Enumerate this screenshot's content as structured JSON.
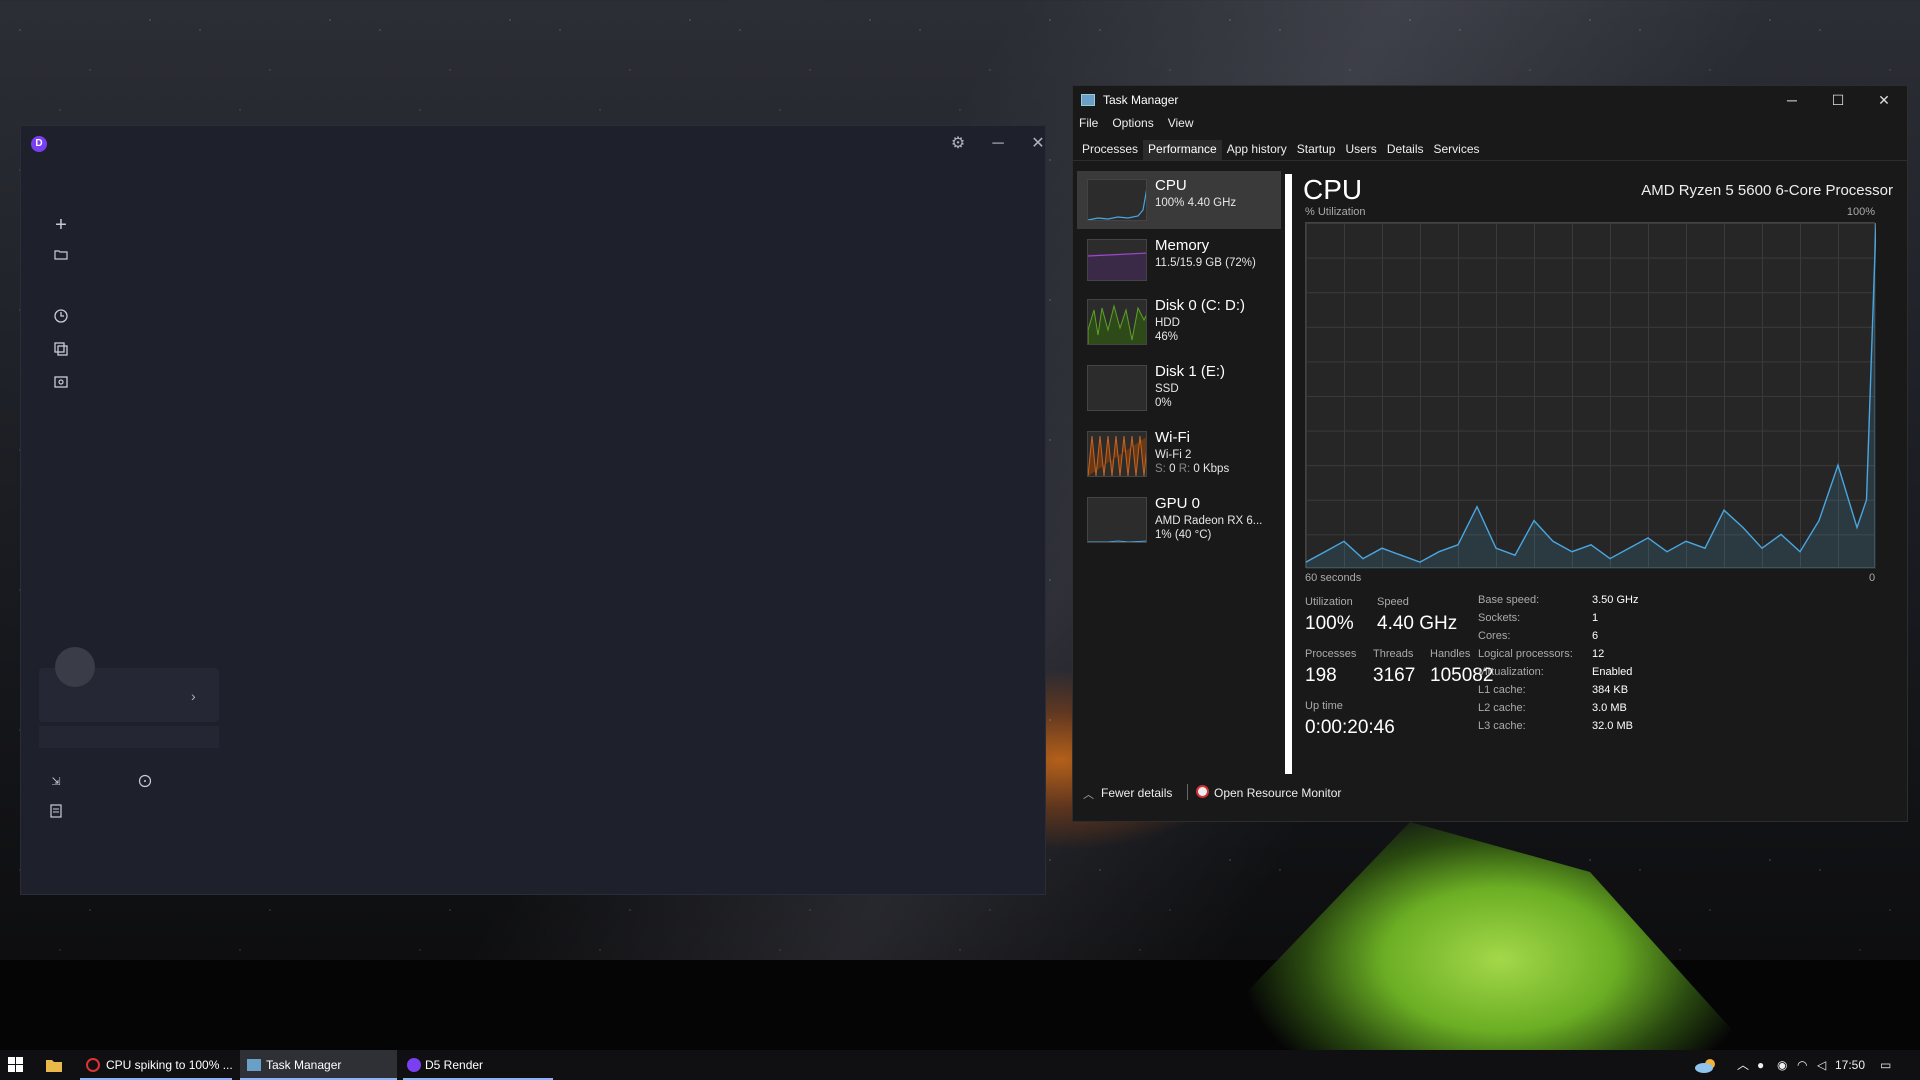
{
  "d5_window": {
    "logo_letter": "D",
    "settings_icon": "gear-icon",
    "minimize": "─",
    "close": "✕",
    "side_icons": [
      "plus-icon",
      "folder-icon",
      "history-icon",
      "copy-icon",
      "gallery-icon"
    ],
    "card_chevron": "›"
  },
  "task_manager": {
    "title": "Task Manager",
    "menu": [
      "File",
      "Options",
      "View"
    ],
    "tabs": [
      "Processes",
      "Performance",
      "App history",
      "Startup",
      "Users",
      "Details",
      "Services"
    ],
    "active_tab": "Performance",
    "resources": [
      {
        "name": "CPU",
        "line1": "100% 4.40 GHz",
        "line2": "",
        "line3": "",
        "color": "#4aa6e0"
      },
      {
        "name": "Memory",
        "line1": "11.5/15.9 GB (72%)",
        "line2": "",
        "line3": "",
        "color": "#9a49c8"
      },
      {
        "name": "Disk 0 (C: D:)",
        "line1": "HDD",
        "line2": "46%",
        "line3": "",
        "color": "#5ea02a"
      },
      {
        "name": "Disk 1 (E:)",
        "line1": "SSD",
        "line2": "0%",
        "line3": "",
        "color": "#5ea02a"
      },
      {
        "name": "Wi-Fi",
        "line1": "Wi-Fi 2",
        "line2_s": "S:",
        "line2_sv": "0",
        "line2_r": "R:",
        "line2_rv": "0 Kbps",
        "color": "#c8641e"
      },
      {
        "name": "GPU 0",
        "line1": "AMD Radeon RX 6...",
        "line2": "1% (40 °C)",
        "line3": "",
        "color": "#4aa6e0"
      }
    ],
    "cpu": {
      "heading": "CPU",
      "processor": "AMD Ryzen 5 5600 6-Core Processor",
      "util_label": "% Utilization",
      "max_label": "100%",
      "time_label": "60 seconds",
      "min_label": "0",
      "utilization_label": "Utilization",
      "utilization": "100%",
      "speed_label": "Speed",
      "speed": "4.40 GHz",
      "processes_label": "Processes",
      "processes": "198",
      "threads_label": "Threads",
      "threads": "3167",
      "handles_label": "Handles",
      "handles": "105082",
      "uptime_label": "Up time",
      "uptime": "0:00:20:46",
      "specs": [
        {
          "k": "Base speed:",
          "v": "3.50 GHz"
        },
        {
          "k": "Sockets:",
          "v": "1"
        },
        {
          "k": "Cores:",
          "v": "6"
        },
        {
          "k": "Logical processors:",
          "v": "12"
        },
        {
          "k": "Virtualization:",
          "v": "Enabled"
        },
        {
          "k": "L1 cache:",
          "v": "384 KB"
        },
        {
          "k": "L2 cache:",
          "v": "3.0 MB"
        },
        {
          "k": "L3 cache:",
          "v": "32.0 MB"
        }
      ]
    },
    "chart_data": {
      "type": "line",
      "title": "CPU",
      "ylabel": "% Utilization",
      "xlabel": "60 seconds",
      "ylim": [
        0,
        100
      ],
      "x": [
        60,
        58,
        56,
        54,
        52,
        50,
        48,
        46,
        44,
        42,
        40,
        38,
        36,
        34,
        32,
        30,
        28,
        26,
        24,
        22,
        20,
        18,
        16,
        14,
        12,
        10,
        8,
        6,
        4,
        2,
        1,
        0
      ],
      "series": [
        {
          "values": [
            2,
            5,
            8,
            3,
            6,
            4,
            2,
            5,
            7,
            18,
            6,
            4,
            14,
            8,
            5,
            7,
            3,
            6,
            9,
            5,
            8,
            6,
            17,
            12,
            6,
            10,
            5,
            14,
            30,
            12,
            20,
            100
          ]
        }
      ]
    },
    "footer": {
      "fewer": "Fewer details",
      "monitor": "Open Resource Monitor"
    }
  },
  "taskbar": {
    "buttons": [
      "CPU spiking to 100% ...",
      "Task Manager",
      "D5 Render"
    ],
    "time": "17:50"
  }
}
